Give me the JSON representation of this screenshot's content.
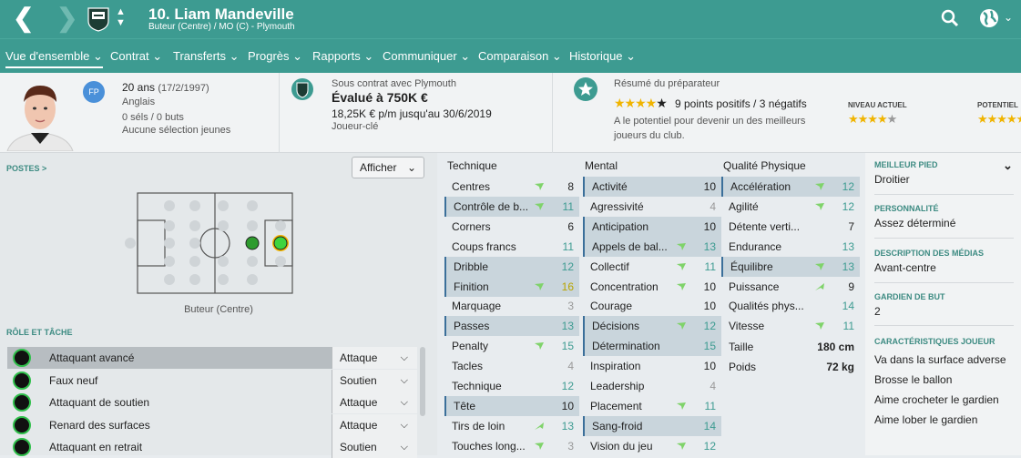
{
  "header": {
    "title": "10. Liam Mandeville",
    "subtitle": "Buteur (Centre) / MO (C) - Plymouth"
  },
  "tabs": [
    {
      "label": "Vue d'ensemble ⌄"
    },
    {
      "label": "Contrat ⌄"
    },
    {
      "label": "Transferts ⌄"
    },
    {
      "label": "Progrès ⌄"
    },
    {
      "label": "Rapports ⌄"
    },
    {
      "label": "Communiquer ⌄"
    },
    {
      "label": "Comparaison ⌄"
    },
    {
      "label": "Historique ⌄"
    }
  ],
  "player": {
    "age": "20 ans",
    "dob": "(17/2/1997)",
    "nationality": "Anglais",
    "caps": "0 séls / 0 buts",
    "youth": "Aucune sélection jeunes",
    "badge": "FP"
  },
  "contract": {
    "label": "Sous contrat avec Plymouth",
    "value": "Évalué à 750K €",
    "wage": "18,25K € p/m jusqu'au 30/6/2019",
    "status": "Joueur-clé"
  },
  "coach": {
    "label": "Résumé du préparateur",
    "points": "9 points positifs / 3 négatifs",
    "text": "A le potentiel pour devenir un des meilleurs joueurs du club.",
    "current_label": "NIVEAU ACTUEL",
    "potential_label": "POTENTIEL",
    "current_stars": 3.5,
    "potential_stars": 4
  },
  "positions": {
    "title": "POSTES >",
    "button": "Afficher",
    "position_name": "Buteur (Centre)"
  },
  "roles": {
    "title": "RÔLE ET TÂCHE",
    "items": [
      {
        "name": "Attaquant avancé",
        "duty": "Attaque"
      },
      {
        "name": "Faux neuf",
        "duty": "Soutien"
      },
      {
        "name": "Attaquant de soutien",
        "duty": "Attaque"
      },
      {
        "name": "Renard des surfaces",
        "duty": "Attaque"
      },
      {
        "name": "Attaquant en retrait",
        "duty": "Soutien"
      }
    ]
  },
  "technique": {
    "title": "Technique",
    "attrs": [
      {
        "name": "Centres",
        "value": "8",
        "arrow": "up",
        "hl": false
      },
      {
        "name": "Contrôle de b...",
        "value": "11",
        "arrow": "up",
        "hl": true
      },
      {
        "name": "Corners",
        "value": "6",
        "arrow": "",
        "hl": false
      },
      {
        "name": "Coups francs",
        "value": "11",
        "arrow": "",
        "hl": false
      },
      {
        "name": "Dribble",
        "value": "12",
        "arrow": "",
        "hl": true
      },
      {
        "name": "Finition",
        "value": "16",
        "arrow": "up",
        "hl": true
      },
      {
        "name": "Marquage",
        "value": "3",
        "arrow": "",
        "hl": false
      },
      {
        "name": "Passes",
        "value": "13",
        "arrow": "",
        "hl": true
      },
      {
        "name": "Penalty",
        "value": "15",
        "arrow": "up",
        "hl": false
      },
      {
        "name": "Tacles",
        "value": "4",
        "arrow": "",
        "hl": false
      },
      {
        "name": "Technique",
        "value": "12",
        "arrow": "",
        "hl": false
      },
      {
        "name": "Tête",
        "value": "10",
        "arrow": "",
        "hl": true
      },
      {
        "name": "Tirs de loin",
        "value": "13",
        "arrow": "up2",
        "hl": false
      },
      {
        "name": "Touches long...",
        "value": "3",
        "arrow": "up",
        "hl": false
      }
    ]
  },
  "mental": {
    "title": "Mental",
    "attrs": [
      {
        "name": "Activité",
        "value": "10",
        "arrow": "",
        "hl": true
      },
      {
        "name": "Agressivité",
        "value": "4",
        "arrow": "",
        "hl": false
      },
      {
        "name": "Anticipation",
        "value": "10",
        "arrow": "",
        "hl": true
      },
      {
        "name": "Appels de bal...",
        "value": "13",
        "arrow": "up",
        "hl": true
      },
      {
        "name": "Collectif",
        "value": "11",
        "arrow": "up",
        "hl": false
      },
      {
        "name": "Concentration",
        "value": "10",
        "arrow": "up",
        "hl": false
      },
      {
        "name": "Courage",
        "value": "10",
        "arrow": "",
        "hl": false
      },
      {
        "name": "Décisions",
        "value": "12",
        "arrow": "up",
        "hl": true
      },
      {
        "name": "Détermination",
        "value": "15",
        "arrow": "",
        "hl": true
      },
      {
        "name": "Inspiration",
        "value": "10",
        "arrow": "",
        "hl": false
      },
      {
        "name": "Leadership",
        "value": "4",
        "arrow": "",
        "hl": false
      },
      {
        "name": "Placement",
        "value": "11",
        "arrow": "up",
        "hl": false
      },
      {
        "name": "Sang-froid",
        "value": "14",
        "arrow": "",
        "hl": true
      },
      {
        "name": "Vision du jeu",
        "value": "12",
        "arrow": "up",
        "hl": false
      }
    ]
  },
  "physical": {
    "title": "Qualité Physique",
    "attrs": [
      {
        "name": "Accélération",
        "value": "12",
        "arrow": "up",
        "hl": true
      },
      {
        "name": "Agilité",
        "value": "12",
        "arrow": "up",
        "hl": false
      },
      {
        "name": "Détente verti...",
        "value": "7",
        "arrow": "",
        "hl": false
      },
      {
        "name": "Endurance",
        "value": "13",
        "arrow": "",
        "hl": false
      },
      {
        "name": "Équilibre",
        "value": "13",
        "arrow": "up",
        "hl": true
      },
      {
        "name": "Puissance",
        "value": "9",
        "arrow": "up2",
        "hl": false
      },
      {
        "name": "Qualités phys...",
        "value": "14",
        "arrow": "",
        "hl": false
      },
      {
        "name": "Vitesse",
        "value": "11",
        "arrow": "up",
        "hl": false
      }
    ],
    "height_label": "Taille",
    "height": "180 cm",
    "weight_label": "Poids",
    "weight": "72 kg"
  },
  "info": [
    {
      "title": "MEILLEUR PIED",
      "value": "Droitier"
    },
    {
      "title": "PERSONNALITÉ",
      "value": "Assez déterminé"
    },
    {
      "title": "DESCRIPTION DES MÉDIAS",
      "value": "Avant-centre"
    },
    {
      "title": "GARDIEN DE BUT",
      "value": "2"
    }
  ],
  "traits": {
    "title": "CARACTÉRISTIQUES JOUEUR",
    "items": [
      "Va dans la surface adverse",
      "Brosse le ballon",
      "Aime crocheter le gardien",
      "Aime lober le gardien"
    ]
  },
  "colors": {
    "accent": "#3d9b91",
    "arrow": "#7fd36a",
    "value_hi": "#3d9b91",
    "value_gold": "#b8a400"
  }
}
